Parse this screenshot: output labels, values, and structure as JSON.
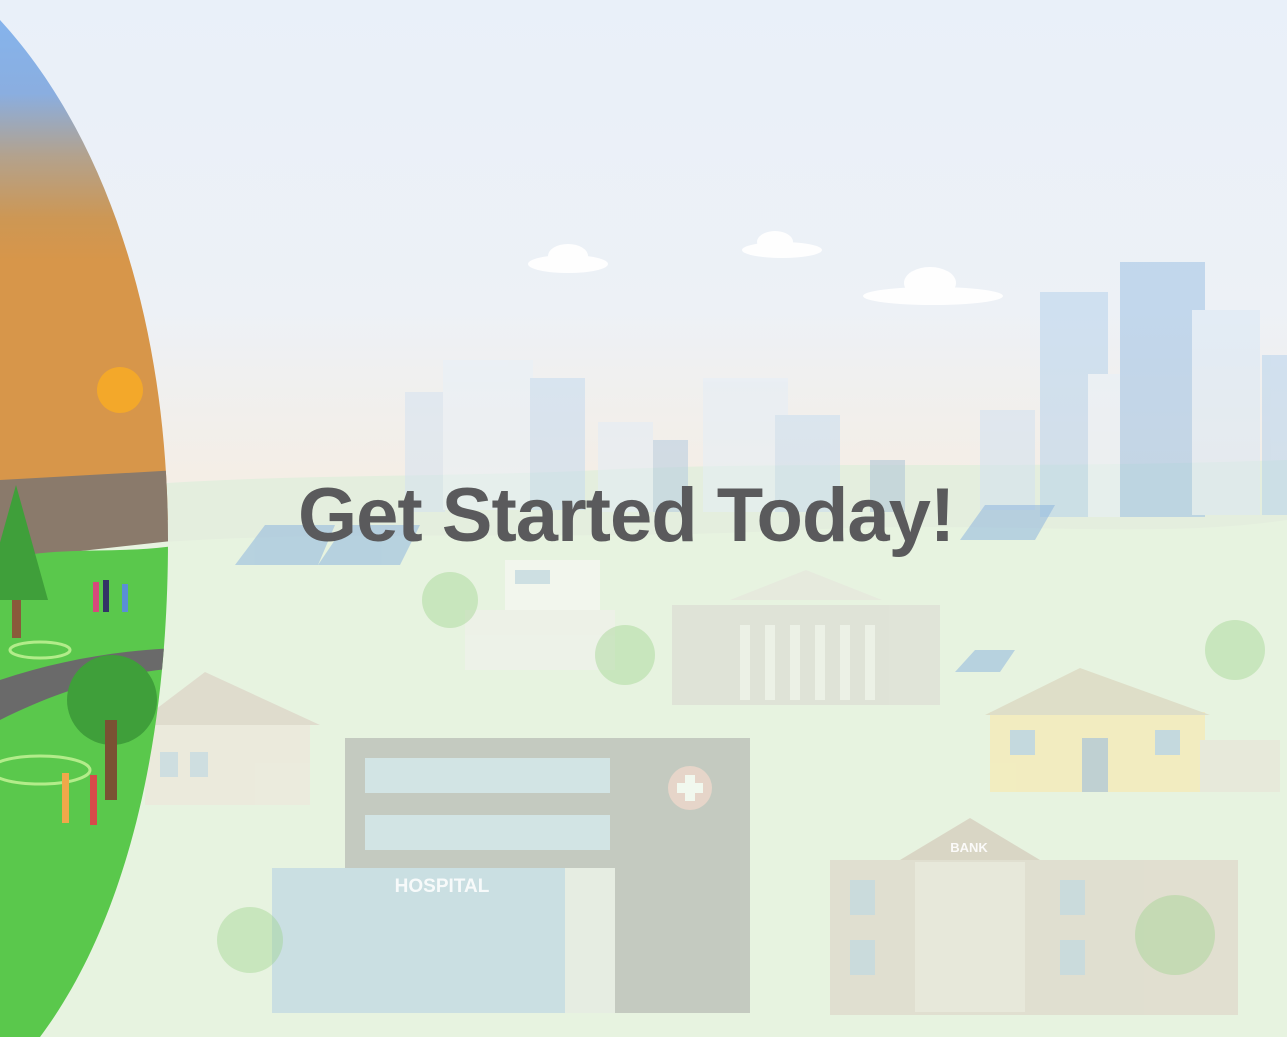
{
  "slide": {
    "headline": "Get Started Today!"
  },
  "scene": {
    "hospital_sign": "HOSPITAL",
    "bank_sign": "BANK"
  },
  "colors": {
    "headline": "#5a5a5c",
    "sky_top": "#e9f0f9",
    "panel_sky_blue": "#8ab7ec",
    "panel_sunset_orange": "#d9944a",
    "sun": "#f3a82a",
    "grass": "#57c748",
    "tree_green": "#3f9f3a"
  }
}
